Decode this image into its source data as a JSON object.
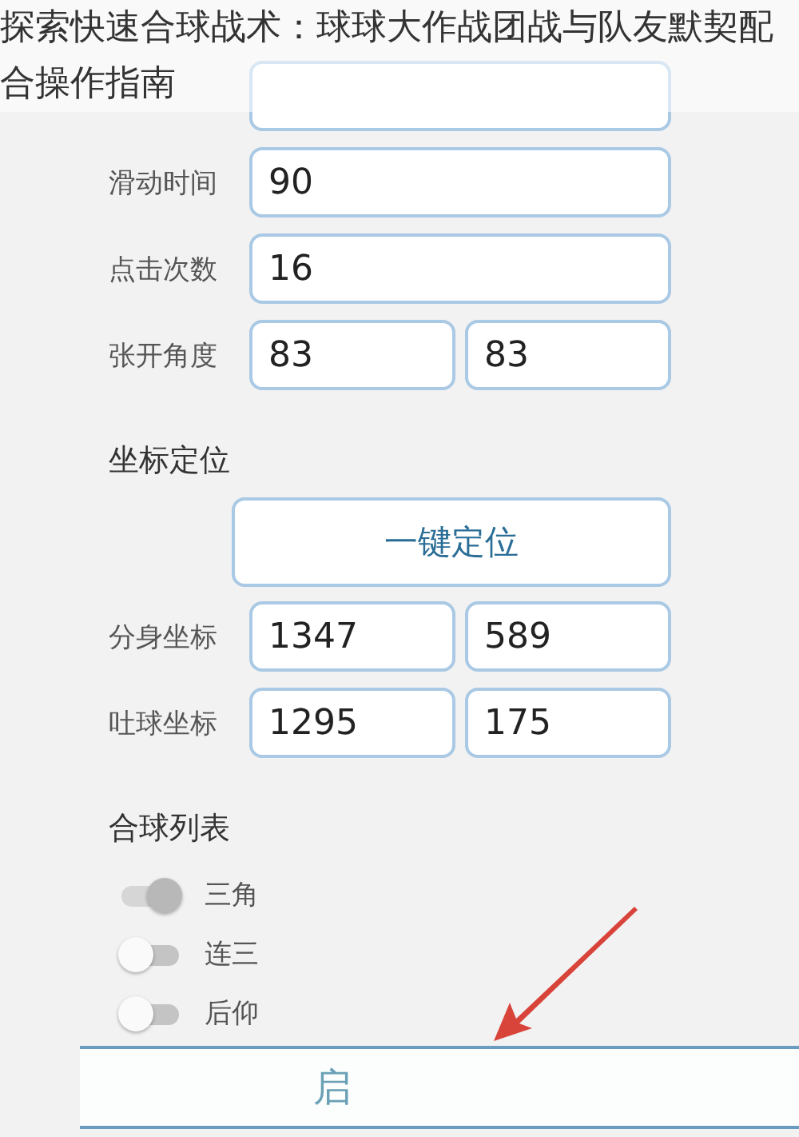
{
  "caption": {
    "title": "探索快速合球战术：球球大作战团战与队友默契配合操作指南"
  },
  "settings": {
    "rows": [
      {
        "label": "滑动时间",
        "values": [
          "90"
        ]
      },
      {
        "label": "点击次数",
        "values": [
          "16"
        ]
      },
      {
        "label": "张开角度",
        "values": [
          "83",
          "83"
        ]
      }
    ]
  },
  "coordinates": {
    "heading": "坐标定位",
    "button": "一键定位",
    "rows": [
      {
        "label": "分身坐标",
        "values": [
          "1347",
          "589"
        ]
      },
      {
        "label": "吐球坐标",
        "values": [
          "1295",
          "175"
        ]
      }
    ]
  },
  "merge_list": {
    "heading": "合球列表",
    "items": [
      {
        "label": "三角",
        "on": true
      },
      {
        "label": "连三",
        "on": false
      },
      {
        "label": "后仰",
        "on": false
      }
    ]
  },
  "start_button": {
    "label": "启"
  }
}
